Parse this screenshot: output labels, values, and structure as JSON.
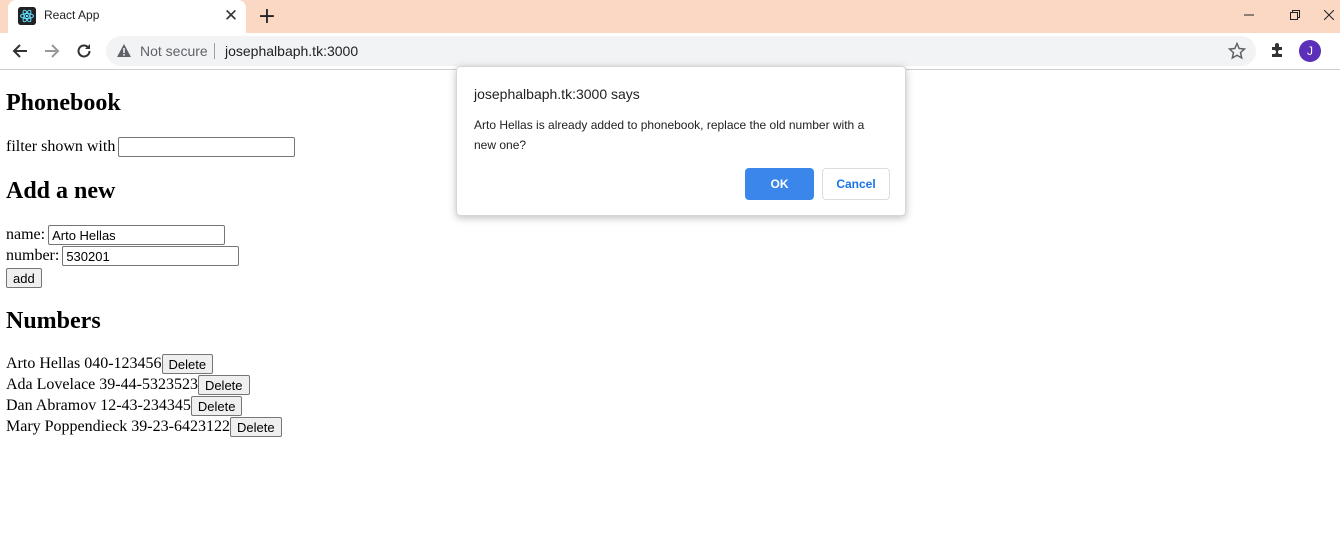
{
  "browser": {
    "tab_title": "React App",
    "omnibox_security": "Not secure",
    "url": "josephalbaph.tk:3000",
    "profile_initial": "J",
    "colors": {
      "tabstrip": "#fbd8c4",
      "profile": "#5b2fb8",
      "accent": "#3b86eb"
    }
  },
  "page": {
    "title": "Phonebook",
    "filter_label": "filter shown with",
    "filter_value": "",
    "add_heading": "Add a new",
    "name_label": "name:",
    "name_value": "Arto Hellas",
    "number_label": "number:",
    "number_value": "530201",
    "add_button": "add",
    "numbers_heading": "Numbers",
    "delete_label": "Delete",
    "persons": [
      {
        "text": "Arto Hellas 040-123456"
      },
      {
        "text": "Ada Lovelace 39-44-5323523"
      },
      {
        "text": "Dan Abramov 12-43-234345"
      },
      {
        "text": "Mary Poppendieck 39-23-6423122"
      }
    ]
  },
  "dialog": {
    "title": "josephalbaph.tk:3000 says",
    "message": "Arto Hellas is already added to phonebook, replace the old number with a new one?",
    "ok_label": "OK",
    "cancel_label": "Cancel"
  }
}
